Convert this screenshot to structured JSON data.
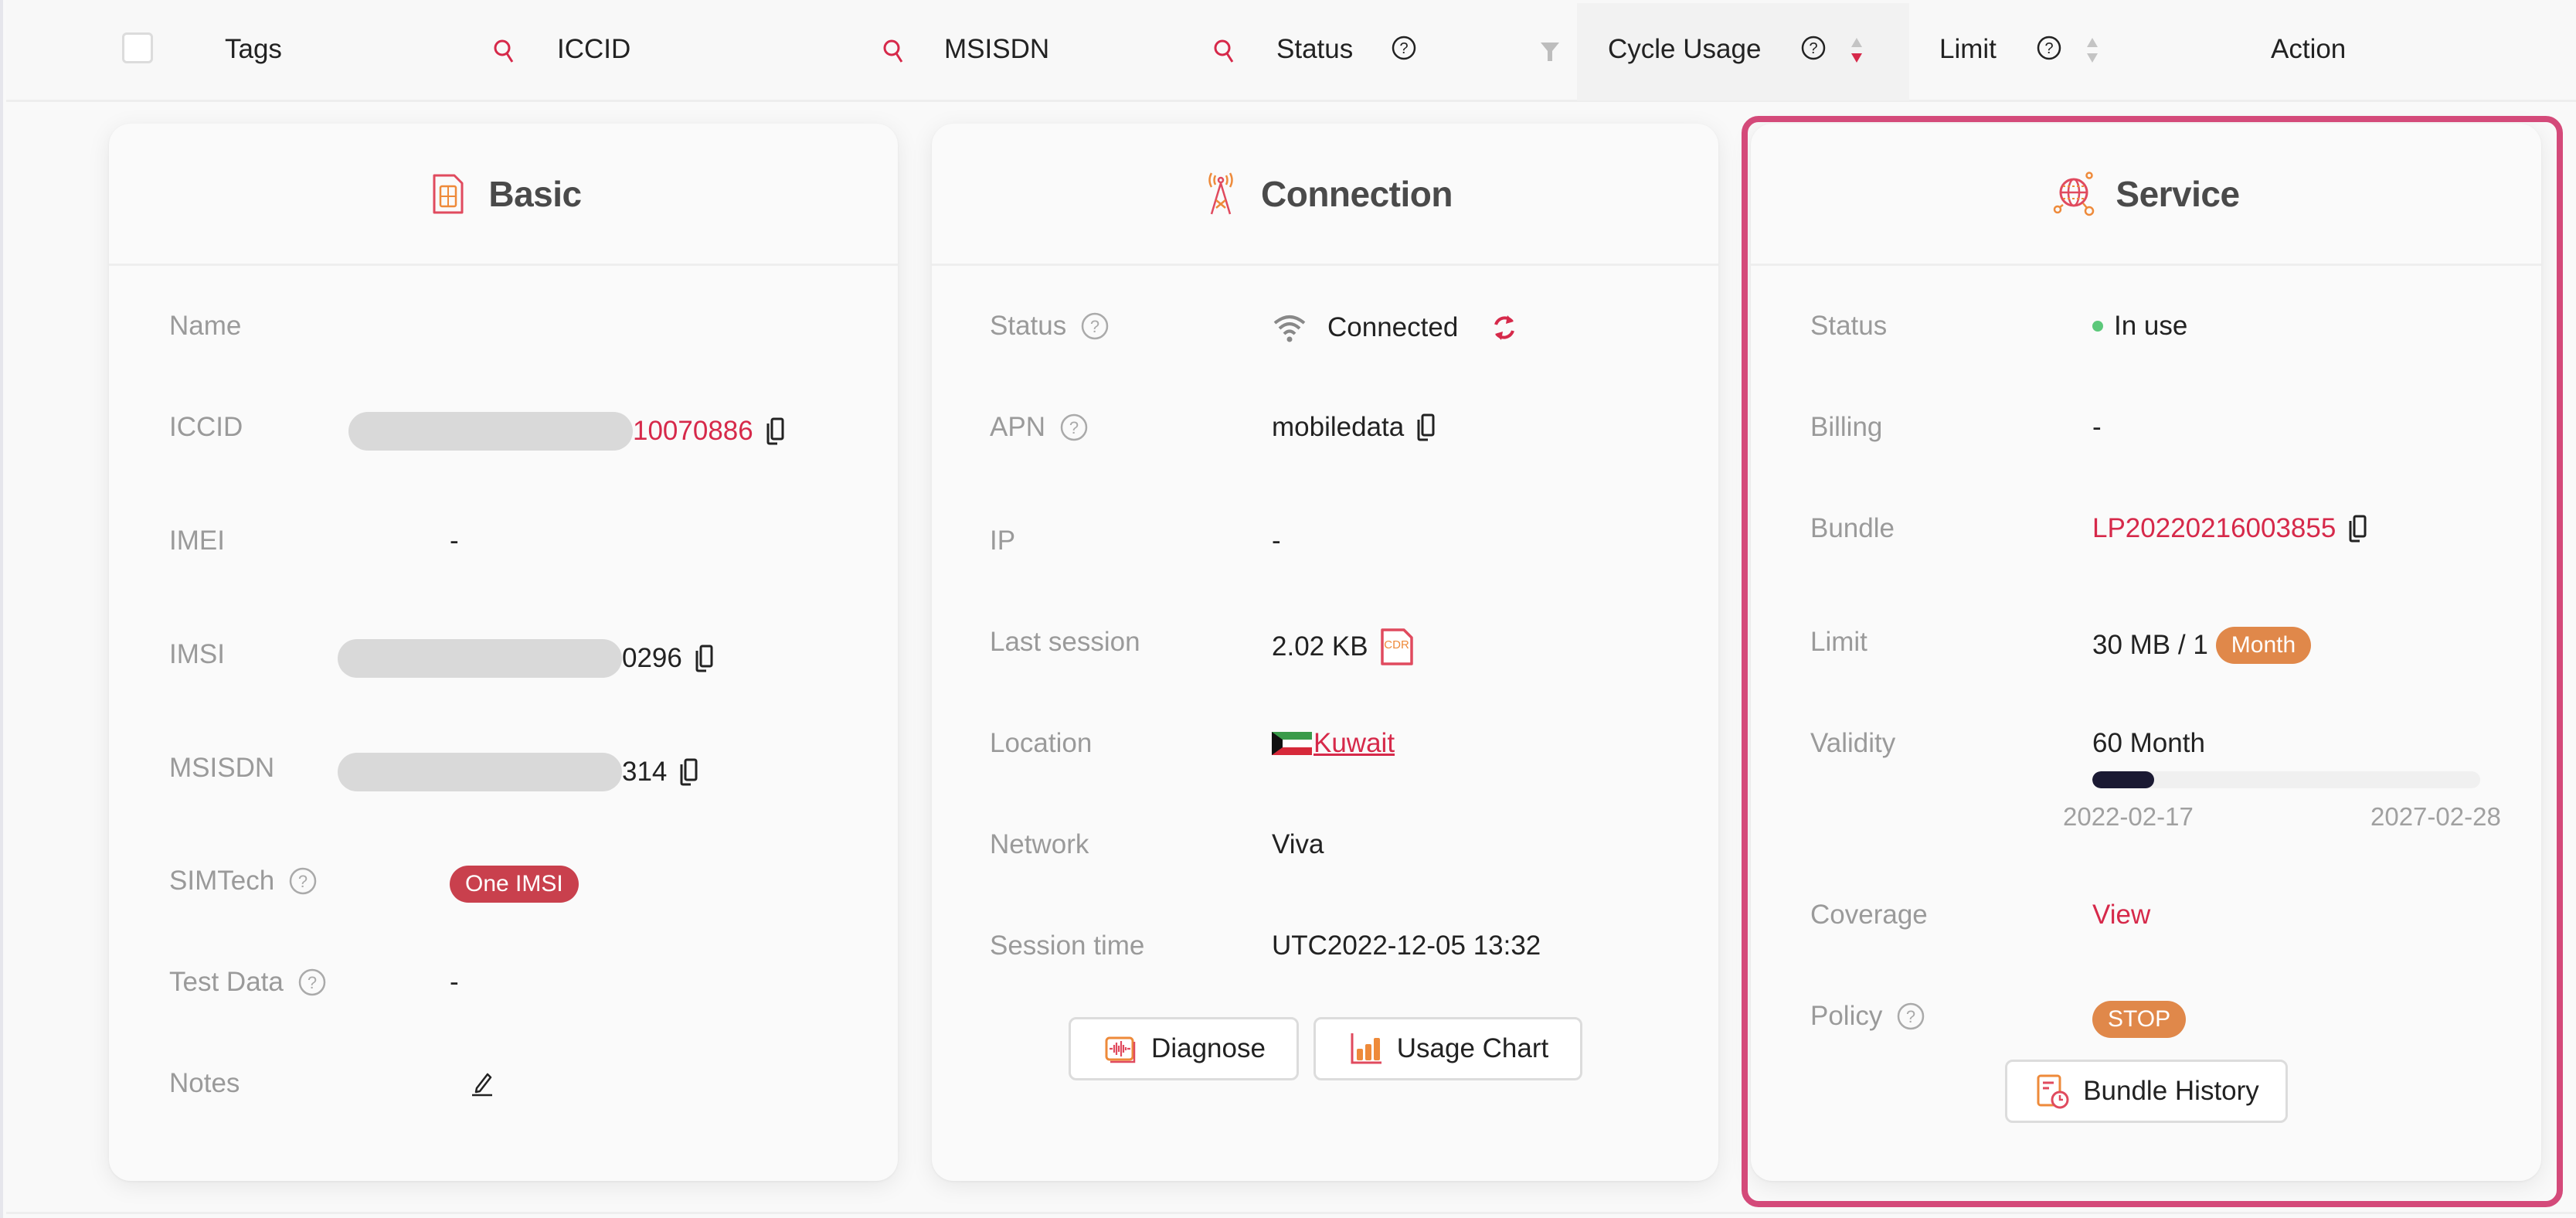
{
  "table_header": {
    "columns": [
      {
        "label": "Tags"
      },
      {
        "label": "ICCID"
      },
      {
        "label": "MSISDN"
      },
      {
        "label": "Status"
      },
      {
        "label": "Cycle Usage",
        "sort": "descending"
      },
      {
        "label": "Limit"
      },
      {
        "label": "Action"
      }
    ]
  },
  "basic": {
    "title": "Basic",
    "rows": {
      "name": {
        "label": "Name",
        "value": ""
      },
      "iccid": {
        "label": "ICCID",
        "value_suffix": "10070886"
      },
      "imei": {
        "label": "IMEI",
        "value": "-"
      },
      "imsi": {
        "label": "IMSI",
        "value_suffix": "0296"
      },
      "msisdn": {
        "label": "MSISDN",
        "value_suffix": "314"
      },
      "simtech": {
        "label": "SIMTech",
        "value": "One IMSI"
      },
      "test_data": {
        "label": "Test Data",
        "value": "-"
      },
      "notes": {
        "label": "Notes"
      }
    }
  },
  "connection": {
    "title": "Connection",
    "rows": {
      "status": {
        "label": "Status",
        "value": "Connected"
      },
      "apn": {
        "label": "APN",
        "value": "mobiledata"
      },
      "ip": {
        "label": "IP",
        "value": "-"
      },
      "last_session": {
        "label": "Last session",
        "value": "2.02 KB",
        "badge": "CDR"
      },
      "location": {
        "label": "Location",
        "value": "Kuwait"
      },
      "network": {
        "label": "Network",
        "value": "Viva"
      },
      "session_time": {
        "label": "Session time",
        "value": "UTC2022-12-05 13:32"
      }
    },
    "buttons": {
      "diagnose": "Diagnose",
      "usage_chart": "Usage Chart"
    }
  },
  "service": {
    "title": "Service",
    "rows": {
      "status": {
        "label": "Status",
        "value": "In use"
      },
      "billing": {
        "label": "Billing",
        "value": "-"
      },
      "bundle": {
        "label": "Bundle",
        "value": "LP20220216003855"
      },
      "limit": {
        "label": "Limit",
        "value": "30 MB / 1",
        "unit": "Month"
      },
      "validity": {
        "label": "Validity",
        "value": "60 Month",
        "progress_fraction": 0.16,
        "start_date": "2022-02-17",
        "end_date": "2027-02-28"
      },
      "coverage": {
        "label": "Coverage",
        "value": "View"
      },
      "policy": {
        "label": "Policy",
        "value": "STOP"
      }
    },
    "buttons": {
      "bundle_history": "Bundle History"
    }
  },
  "colors": {
    "accent_red": "#d6294a",
    "accent_orange": "#e0884a",
    "status_green": "#5cc87a",
    "badge_red": "#c9404d",
    "highlight_pink": "#d44a7a",
    "progress_fill": "#1b1a33"
  }
}
